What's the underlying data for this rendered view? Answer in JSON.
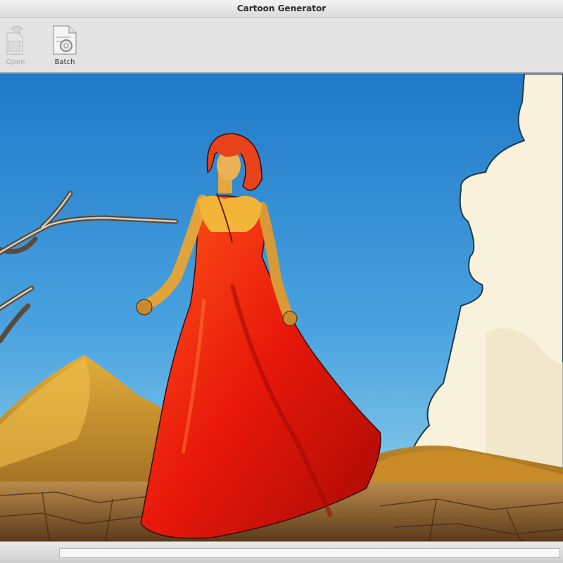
{
  "window": {
    "title": "Cartoon Generator"
  },
  "toolbar": {
    "open_label": "Open",
    "batch_label": "Batch"
  },
  "canvas": {
    "description_icon": "cartoon-image",
    "colors": {
      "sky_top": "#1f79c8",
      "sky_bottom": "#8fd0ea",
      "dress": "#e8180a",
      "cloud": "#f8f1dc",
      "desert": "#c7942e"
    }
  }
}
